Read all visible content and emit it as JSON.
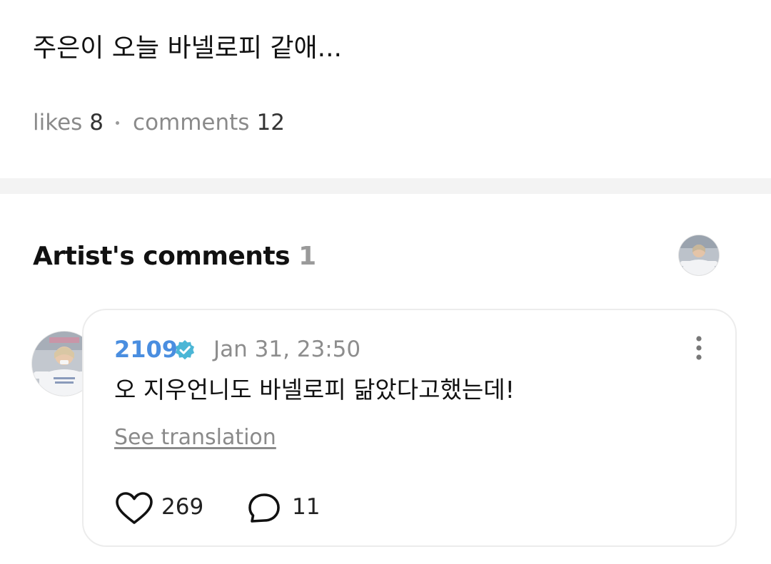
{
  "post": {
    "text": "주은이 오늘 바넬로피 같애...",
    "likes_label": "likes",
    "likes_count": "8",
    "comments_label": "comments",
    "comments_count": "12"
  },
  "artist_comments": {
    "title": "Artist's comments",
    "count": "1"
  },
  "comment": {
    "author": "2109",
    "verified": true,
    "timestamp": "Jan 31, 23:50",
    "text": "오 지우언니도 바넬로피 닮았다고했는데!",
    "translate_label": "See translation",
    "likes": "269",
    "replies": "11"
  },
  "colors": {
    "author": "#4a8ee0",
    "verified_badge": "#4bb6d6",
    "muted_text": "#8a8a8a",
    "divider": "#f3f3f3",
    "card_border": "#ececec"
  },
  "icons": {
    "verified": "verified-badge-icon",
    "more": "more-vertical-icon",
    "like": "heart-outline-icon",
    "reply": "speech-bubble-icon"
  }
}
